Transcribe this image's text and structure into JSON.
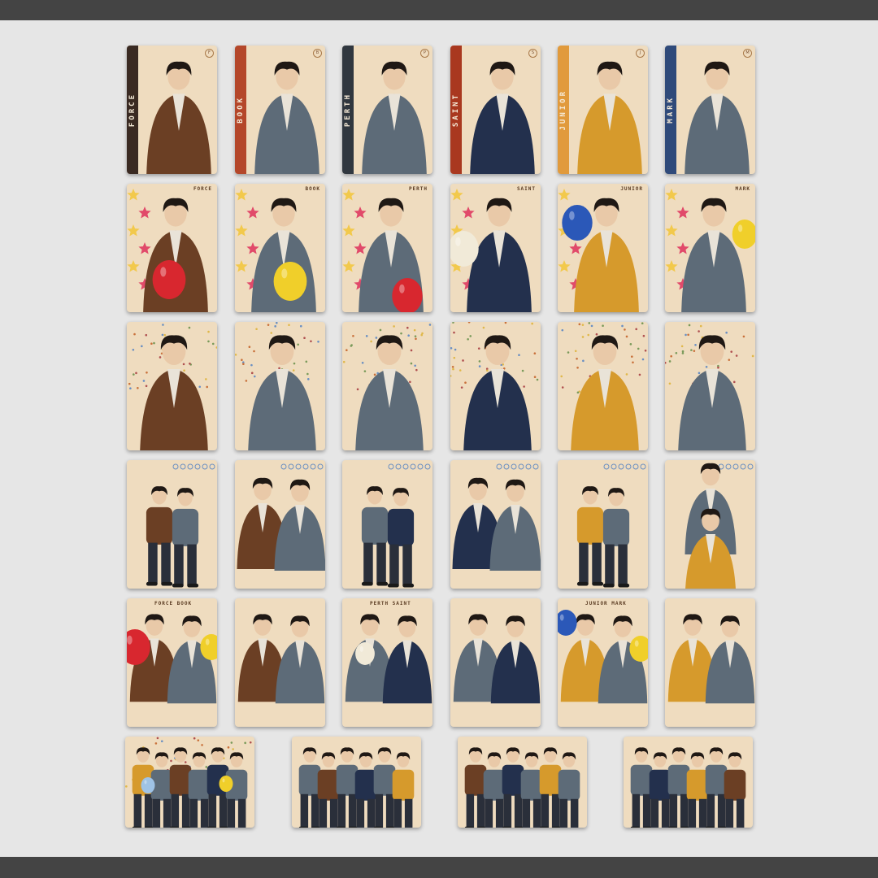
{
  "profile_names": [
    "FORCE",
    "BOOK",
    "PERTH",
    "SAINT",
    "JUNIOR",
    "MARK"
  ],
  "profile_initials": [
    "F",
    "B",
    "P",
    "S",
    "J",
    "M"
  ],
  "pair_names": [
    "FORCE BOOK",
    "PERTH SAINT",
    "JUNIOR MARK"
  ],
  "colors": {
    "frame_bar": "#444444",
    "page_bg": "#e6e6e6",
    "card_bg": "#efdcbf",
    "stripe": [
      "#3a2a22",
      "#b4472a",
      "#30373f",
      "#a9381f",
      "#e19a3c",
      "#2f4a7a"
    ],
    "balloon_red": "#d8272f",
    "balloon_yellow": "#f0cf2a",
    "balloon_blue": "#2b58b8",
    "jacket_brown": "#6b3f24",
    "jacket_denim": "#5d6b78",
    "jacket_navy": "#23304d",
    "jacket_mustard": "#d69a2c"
  }
}
